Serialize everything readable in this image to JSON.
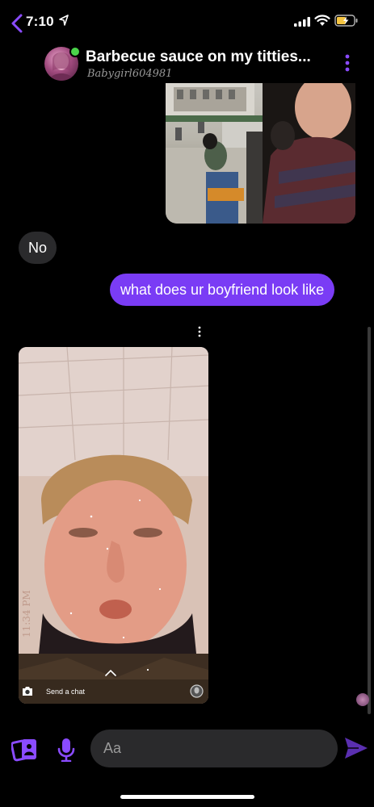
{
  "status_bar": {
    "time": "7:10"
  },
  "header": {
    "title": "Barbecue sauce on my titties...",
    "subtitle": "Babygirl604981",
    "accent_color": "#8a4bff",
    "online_color": "#4ad34a"
  },
  "messages": [
    {
      "type": "photo",
      "from": "them",
      "icon": "photo-image"
    },
    {
      "type": "text",
      "from": "them",
      "text": "No"
    },
    {
      "type": "text",
      "from": "me",
      "text": "what does ur boyfriend look like"
    },
    {
      "type": "snap",
      "from": "them",
      "send_label": "Send a chat"
    }
  ],
  "composer": {
    "placeholder": "Aa",
    "icons": [
      "cards-icon",
      "mic-icon",
      "send-icon"
    ]
  },
  "colors": {
    "background": "#000000",
    "bubble_them": "#2a2a2c",
    "bubble_me": "#7a3cf5",
    "icon_purple": "#8a4bff"
  }
}
